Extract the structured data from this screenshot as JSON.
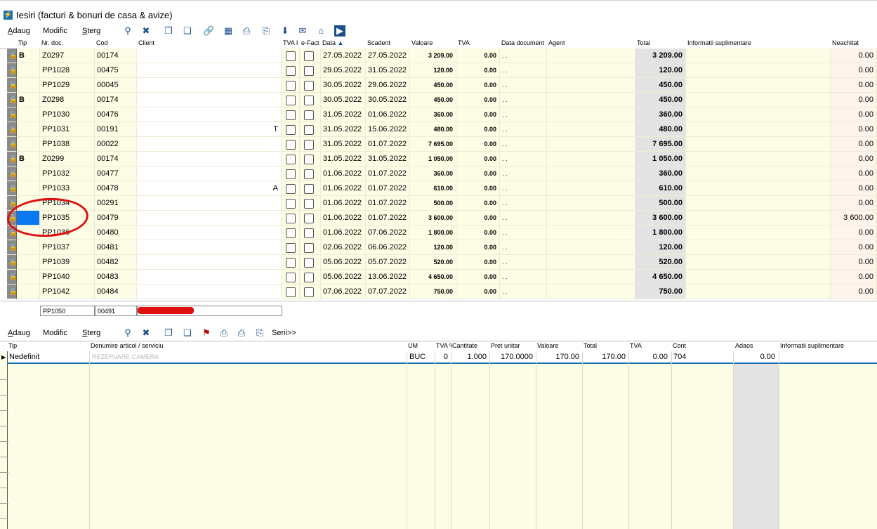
{
  "window": {
    "title": "Iesiri (facturi & bonuri de casa & avize)",
    "icon": "lightning-icon"
  },
  "toolbar_top": {
    "add_prefix": "A",
    "add_label": "daug",
    "edit_prefix": "M",
    "edit_label": "odific",
    "delete_prefix": "S",
    "delete_label": "terg"
  },
  "invoice_grid": {
    "headers": [
      "Tip",
      "Nr. doc.",
      "Cod",
      "Client",
      "TVA I",
      "e-Fact",
      "Data",
      "Scadent",
      "Valoare",
      "TVA",
      "Data document",
      "Agent",
      "Total",
      "Informatii suplimentare",
      "Neachitat"
    ],
    "sort_indicator": "▲",
    "rows": [
      {
        "tip": "B",
        "nr": "Z0297",
        "cod": "00174",
        "client_tail": "",
        "data": "27.05.2022",
        "scadent": "27.05.2022",
        "valoare": "3 209.00",
        "tva": "0.00",
        "datadoc": ". .",
        "total": "3 209.00",
        "neachitat": "0.00"
      },
      {
        "tip": "",
        "nr": "PP1028",
        "cod": "00475",
        "client_tail": "",
        "data": "29.05.2022",
        "scadent": "31.05.2022",
        "valoare": "120.00",
        "tva": "0.00",
        "datadoc": ". .",
        "total": "120.00",
        "neachitat": "0.00"
      },
      {
        "tip": "",
        "nr": "PP1029",
        "cod": "00045",
        "client_tail": "",
        "data": "30.05.2022",
        "scadent": "29.06.2022",
        "valoare": "450.00",
        "tva": "0.00",
        "datadoc": ". .",
        "total": "450.00",
        "neachitat": "0.00"
      },
      {
        "tip": "B",
        "nr": "Z0298",
        "cod": "00174",
        "client_tail": "",
        "data": "30.05.2022",
        "scadent": "30.05.2022",
        "valoare": "450.00",
        "tva": "0.00",
        "datadoc": ". .",
        "total": "450.00",
        "neachitat": "0.00"
      },
      {
        "tip": "",
        "nr": "PP1030",
        "cod": "00476",
        "client_tail": "",
        "data": "31.05.2022",
        "scadent": "01.06.2022",
        "valoare": "360.00",
        "tva": "0.00",
        "datadoc": ". .",
        "total": "360.00",
        "neachitat": "0.00"
      },
      {
        "tip": "",
        "nr": "PP1031",
        "cod": "00191",
        "client_tail": "T",
        "data": "31.05.2022",
        "scadent": "15.06.2022",
        "valoare": "480.00",
        "tva": "0.00",
        "datadoc": ". .",
        "total": "480.00",
        "neachitat": "0.00"
      },
      {
        "tip": "",
        "nr": "PP1038",
        "cod": "00022",
        "client_tail": "",
        "data": "31.05.2022",
        "scadent": "01.07.2022",
        "valoare": "7 695.00",
        "tva": "0.00",
        "datadoc": ". .",
        "total": "7 695.00",
        "neachitat": "0.00"
      },
      {
        "tip": "B",
        "nr": "Z0299",
        "cod": "00174",
        "client_tail": "",
        "data": "31.05.2022",
        "scadent": "31.05.2022",
        "valoare": "1 050.00",
        "tva": "0.00",
        "datadoc": ". .",
        "total": "1 050.00",
        "neachitat": "0.00"
      },
      {
        "tip": "",
        "nr": "PP1032",
        "cod": "00477",
        "client_tail": "",
        "data": "01.06.2022",
        "scadent": "01.07.2022",
        "valoare": "360.00",
        "tva": "0.00",
        "datadoc": ". .",
        "total": "360.00",
        "neachitat": "0.00"
      },
      {
        "tip": "",
        "nr": "PP1033",
        "cod": "00478",
        "client_tail": "A",
        "data": "01.06.2022",
        "scadent": "01.07.2022",
        "valoare": "610.00",
        "tva": "0.00",
        "datadoc": ". .",
        "total": "610.00",
        "neachitat": "0.00"
      },
      {
        "tip": "",
        "nr": "PP1034",
        "cod": "00291",
        "client_tail": "",
        "data": "01.06.2022",
        "scadent": "01.07.2022",
        "valoare": "500.00",
        "tva": "0.00",
        "datadoc": ". .",
        "total": "500.00",
        "neachitat": "0.00"
      },
      {
        "tip": "",
        "nr": "PP1035",
        "cod": "00479",
        "client_tail": "",
        "data": "01.06.2022",
        "scadent": "01.07.2022",
        "valoare": "3 600.00",
        "tva": "0.00",
        "datadoc": ". .",
        "total": "3 600.00",
        "neachitat": "3 600.00",
        "selected": true
      },
      {
        "tip": "",
        "nr": "PP1036",
        "cod": "00480",
        "client_tail": "",
        "data": "01.06.2022",
        "scadent": "07.06.2022",
        "valoare": "1 800.00",
        "tva": "0.00",
        "datadoc": ". .",
        "total": "1 800.00",
        "neachitat": "0.00"
      },
      {
        "tip": "",
        "nr": "PP1037",
        "cod": "00481",
        "client_tail": "",
        "data": "02.06.2022",
        "scadent": "06.06.2022",
        "valoare": "120.00",
        "tva": "0.00",
        "datadoc": ". .",
        "total": "120.00",
        "neachitat": "0.00"
      },
      {
        "tip": "",
        "nr": "PP1039",
        "cod": "00482",
        "client_tail": "",
        "data": "05.06.2022",
        "scadent": "05.07.2022",
        "valoare": "520.00",
        "tva": "0.00",
        "datadoc": ". .",
        "total": "520.00",
        "neachitat": "0.00"
      },
      {
        "tip": "",
        "nr": "PP1040",
        "cod": "00483",
        "client_tail": "",
        "data": "05.06.2022",
        "scadent": "13.06.2022",
        "valoare": "4 650.00",
        "tva": "0.00",
        "datadoc": ". .",
        "total": "4 650.00",
        "neachitat": "0.00"
      },
      {
        "tip": "",
        "nr": "PP1042",
        "cod": "00484",
        "client_tail": "",
        "data": "07.06.2022",
        "scadent": "07.07.2022",
        "valoare": "750.00",
        "tva": "0.00",
        "datadoc": ". .",
        "total": "750.00",
        "neachitat": "0.00"
      }
    ]
  },
  "filter_row": {
    "nr": "PP1050",
    "cod": "00491"
  },
  "toolbar_bottom": {
    "add_prefix": "A",
    "add_label": "daug",
    "edit_prefix": "M",
    "edit_label": "odific",
    "delete_prefix": "S",
    "delete_label": "terg",
    "series_label": "Serii>>"
  },
  "lines_grid": {
    "headers": [
      "Tip",
      "Denumire articol / serviciu",
      "UM",
      "TVA %",
      "Cantitate",
      "Pret unitar",
      "Valoare",
      "Total",
      "TVA",
      "Cont",
      "Adaos",
      "Informatii suplimentare"
    ],
    "rows": [
      {
        "tip": "Nedefinit",
        "denumire": "REZERVARE CAMERA",
        "um": "BUC",
        "tva_pct": "0",
        "cantitate": "1.000",
        "pret": "170.0000",
        "valoare": "170.00",
        "total": "170.00",
        "tva": "0.00",
        "cont": "704",
        "adaos": "0.00"
      }
    ]
  },
  "colors": {
    "cream": "#fdfde6",
    "selection": "#0a78f0",
    "annotation": "#e01010"
  }
}
